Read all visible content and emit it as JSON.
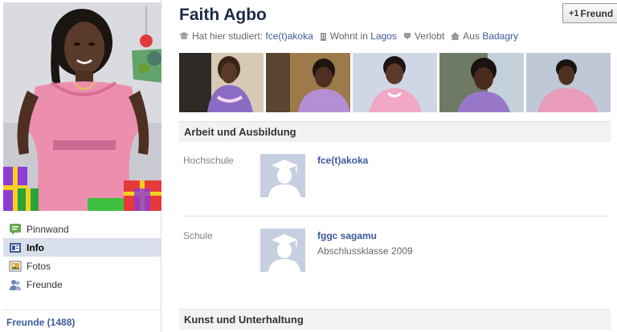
{
  "profile": {
    "name": "Faith Agbo",
    "add_friend_label": "Freund"
  },
  "facts": [
    {
      "icon": "education-icon",
      "prefix": "Hat hier studiert:",
      "link": "fce(t)akoka"
    },
    {
      "icon": "home-icon",
      "prefix": "Wohnt in",
      "link": "Lagos"
    },
    {
      "icon": "heart-icon",
      "prefix": "Verlobt",
      "link": ""
    },
    {
      "icon": "house-icon",
      "prefix": "Aus",
      "link": "Badagry"
    }
  ],
  "nav": {
    "items": [
      {
        "label": "Pinnwand",
        "icon": "wall-icon"
      },
      {
        "label": "Info",
        "icon": "info-icon",
        "active": true
      },
      {
        "label": "Fotos",
        "icon": "photos-icon"
      },
      {
        "label": "Freunde",
        "icon": "friends-icon"
      }
    ],
    "friends_count_label": "Freunde (1488)"
  },
  "sections": {
    "work_edu": "Arbeit und Ausbildung",
    "arts": "Kunst und Unterhaltung"
  },
  "education": [
    {
      "label": "Hochschule",
      "name": "fce(t)akoka",
      "sub": ""
    },
    {
      "label": "Schule",
      "name": "fggc sagamu",
      "sub": "Abschlussklasse 2009"
    }
  ],
  "colors": {
    "link": "#3b5998",
    "name": "#1c2a47",
    "active_nav": "#d8dfea"
  }
}
